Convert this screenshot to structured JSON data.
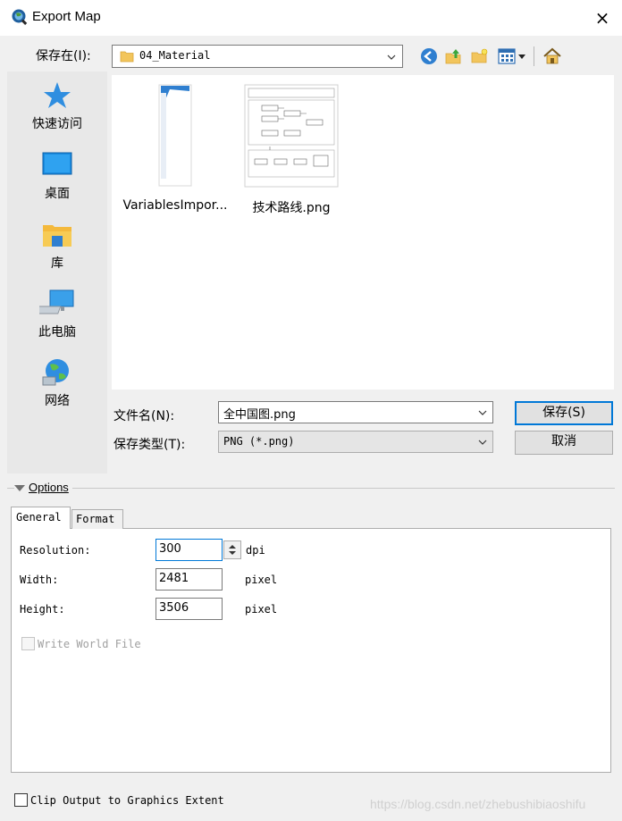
{
  "window": {
    "title": "Export Map",
    "app_icon": "arcmap-globe-icon",
    "close": "×"
  },
  "toolbar": {
    "save_in_label": "保存在(I):",
    "save_in_value": "04_Material",
    "icons": [
      "back-icon",
      "up-folder-icon",
      "new-folder-icon",
      "views-menu-icon",
      "home-icon"
    ]
  },
  "places": [
    {
      "label": "快速访问",
      "icon": "star-icon"
    },
    {
      "label": "桌面",
      "icon": "desktop-icon"
    },
    {
      "label": "库",
      "icon": "library-icon"
    },
    {
      "label": "此电脑",
      "icon": "computer-icon"
    },
    {
      "label": "网络",
      "icon": "network-icon"
    }
  ],
  "files": [
    {
      "name": "VariablesImpor...",
      "type": "thumbnail"
    },
    {
      "name": "技术路线.png",
      "type": "thumbnail"
    }
  ],
  "filename": {
    "label": "文件名(N):",
    "value": "全中国图.png"
  },
  "filetype": {
    "label": "保存类型(T):",
    "value": "PNG (*.png)"
  },
  "buttons": {
    "save": "保存(S)",
    "cancel": "取消"
  },
  "options": {
    "header": "Options",
    "tabs": [
      "General",
      "Format"
    ],
    "active_tab": "General",
    "resolution": {
      "label": "Resolution:",
      "value": "300",
      "unit": "dpi"
    },
    "width": {
      "label": "Width:",
      "value": "2481",
      "unit": "pixel"
    },
    "height": {
      "label": "Height:",
      "value": "3506",
      "unit": "pixel"
    },
    "world_file": {
      "label": "Write World File",
      "checked": false,
      "enabled": false
    }
  },
  "clip_output": {
    "label": "Clip Output to Graphics Extent",
    "checked": false
  },
  "watermark": "https://blog.csdn.net/zhebushibiaoshifu",
  "colors": {
    "accent": "#0078d7",
    "panel": "#ffffff",
    "background": "#f0f0f0"
  }
}
